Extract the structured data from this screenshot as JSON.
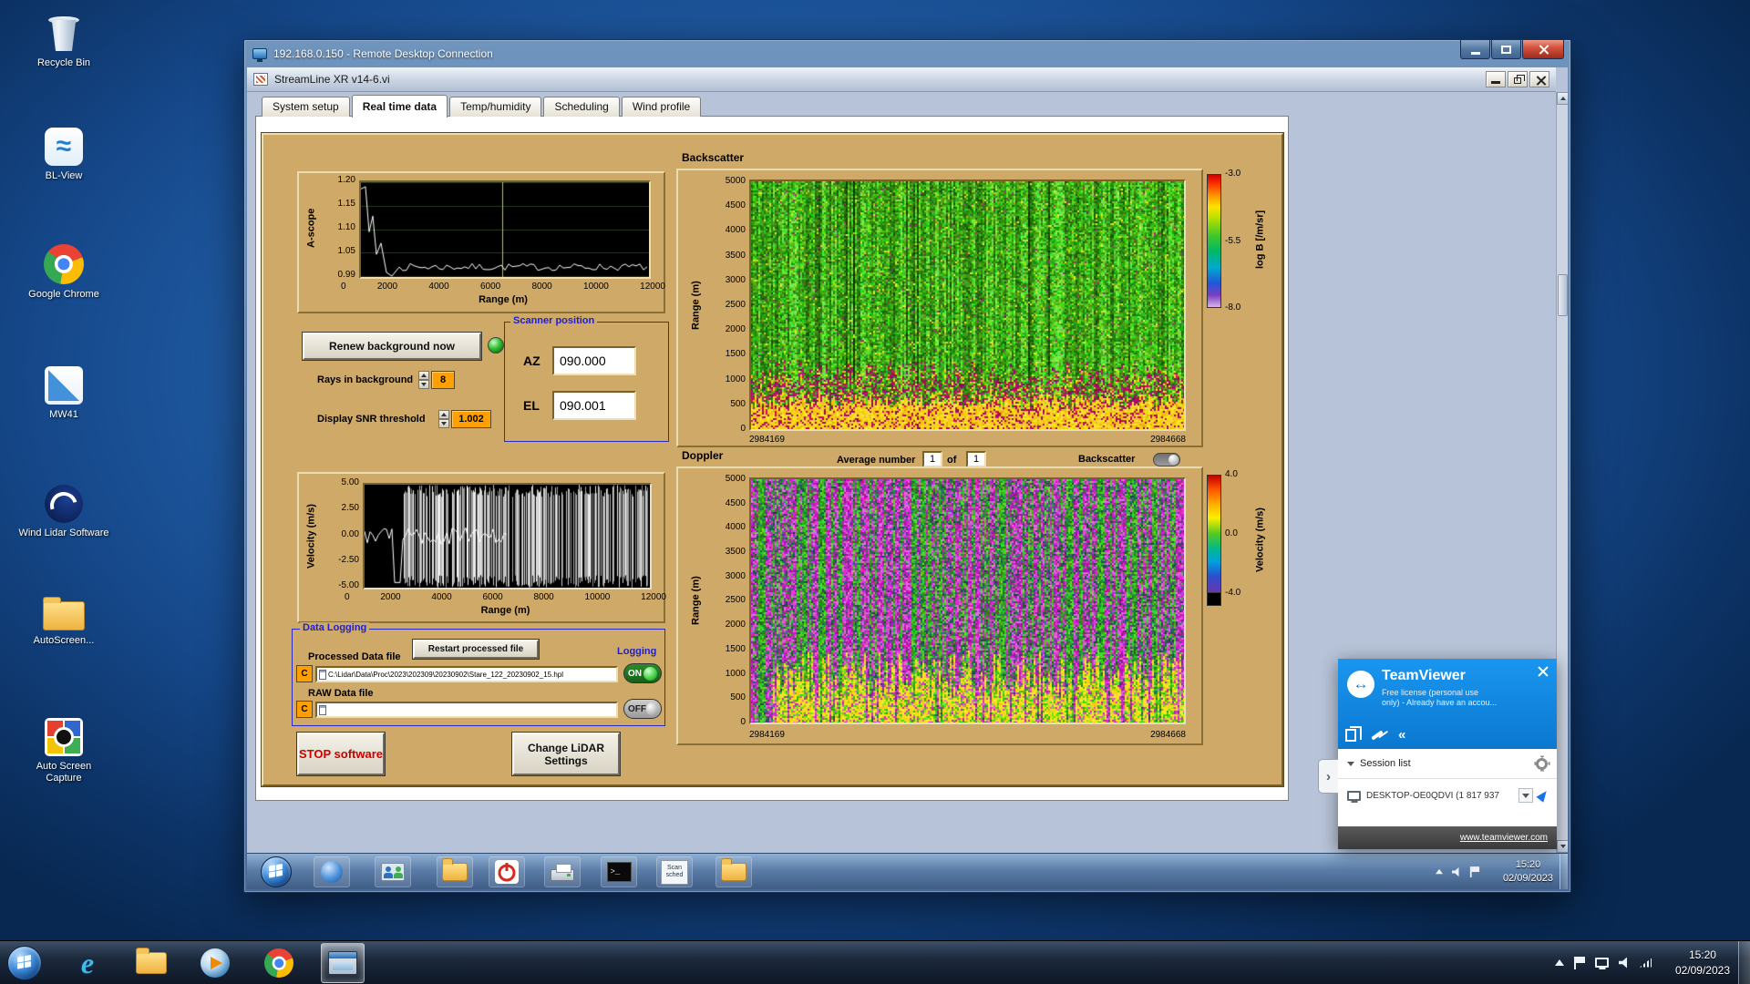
{
  "desktop": {
    "icons": [
      {
        "label": "Recycle Bin"
      },
      {
        "label": "BL-View"
      },
      {
        "label": "Google Chrome"
      },
      {
        "label": "MW41"
      },
      {
        "label": "Wind Lidar Software"
      },
      {
        "label": "AutoScreen..."
      },
      {
        "label": "Auto Screen Capture"
      }
    ]
  },
  "rdp": {
    "title": "192.168.0.150 - Remote Desktop Connection"
  },
  "app": {
    "title": "StreamLine XR v14-6.vi",
    "tabs": [
      {
        "label": "System setup"
      },
      {
        "label": "Real time data"
      },
      {
        "label": "Temp/humidity"
      },
      {
        "label": "Scheduling"
      },
      {
        "label": "Wind profile"
      }
    ]
  },
  "ascope": {
    "y_label": "A-scope",
    "x_label": "Range (m)",
    "y_ticks": [
      "1.20",
      "1.15",
      "1.10",
      "1.05",
      "0.99"
    ],
    "x_ticks": [
      "0",
      "2000",
      "4000",
      "6000",
      "8000",
      "10000",
      "12000"
    ]
  },
  "backscatter": {
    "section_title": "Backscatter",
    "y_label": "Range (m)",
    "y_ticks": [
      "5000",
      "4500",
      "4000",
      "3500",
      "3000",
      "2500",
      "2000",
      "1500",
      "1000",
      "500",
      "0"
    ],
    "x_start": "2984169",
    "x_end": "2984668",
    "colorbar_ticks": [
      "-3.0",
      "-5.5",
      "-8.0"
    ],
    "colorbar_label": "log B [/m/sr]"
  },
  "scanner": {
    "box_title": "Scanner position",
    "az_label": "AZ",
    "az_value": "090.000",
    "el_label": "EL",
    "el_value": "090.001"
  },
  "background_controls": {
    "renew_button": "Renew background now",
    "rays_label": "Rays in background",
    "rays_value": "8",
    "snr_label": "Display SNR threshold",
    "snr_value": "1.002"
  },
  "doppler": {
    "section_title": "Doppler",
    "average_label": "Average number",
    "average_value": "1",
    "of_label": "of",
    "average_total": "1",
    "toggle_label": "Backscatter",
    "y_label": "Range (m)",
    "y_ticks": [
      "5000",
      "4500",
      "4000",
      "3500",
      "3000",
      "2500",
      "2000",
      "1500",
      "1000",
      "500",
      "0"
    ],
    "x_start": "2984169",
    "x_end": "2984668",
    "colorbar_ticks": [
      "4.0",
      "0.0",
      "-4.0"
    ],
    "colorbar_label": "Velocity (m/s)"
  },
  "velocity": {
    "y_label": "Velocity (m/s)",
    "x_label": "Range (m)",
    "y_ticks": [
      "5.00",
      "2.50",
      "0.00",
      "-2.50",
      "-5.00"
    ],
    "x_ticks": [
      "0",
      "2000",
      "4000",
      "6000",
      "8000",
      "10000",
      "12000"
    ]
  },
  "logging": {
    "box_title": "Data Logging",
    "processed_label": "Processed Data file",
    "restart_button": "Restart processed file",
    "logging_label": "Logging",
    "drive_letter": "C",
    "processed_path": "C:\\Lidar\\Data\\Proc\\2023\\202309\\20230902\\Stare_122_20230902_15.hpl",
    "on_label": "ON",
    "raw_label": "RAW Data file",
    "raw_path": "",
    "off_label": "OFF"
  },
  "actions": {
    "stop_button": "STOP software",
    "settings_button": "Change LiDAR Settings"
  },
  "remote_taskbar": {
    "icons": [
      "network-sphere-icon",
      "remote-users-icon",
      "folders-icon",
      "power-off-icon",
      "printer-icon",
      "command-prompt-icon",
      "scan-scheduler-icon",
      "file-explorer-icon"
    ],
    "scan_icon_label": "Scan sched",
    "time": "15:20",
    "date": "02/09/2023"
  },
  "teamviewer": {
    "title": "TeamViewer",
    "subtitle_line1": "Free license (personal use",
    "subtitle_line2": "only) - Already have an accou...",
    "session_list_label": "Session list",
    "device_entry": "DESKTOP-OE0QDVI (1 817 937",
    "website_link": "www.teamviewer.com"
  },
  "host_taskbar": {
    "icons": [
      "start-orb",
      "internet-explorer-icon",
      "file-explorer-icon",
      "media-player-icon",
      "chrome-icon",
      "remote-desktop-icon"
    ],
    "time": "15:20",
    "date": "02/09/2023"
  }
}
